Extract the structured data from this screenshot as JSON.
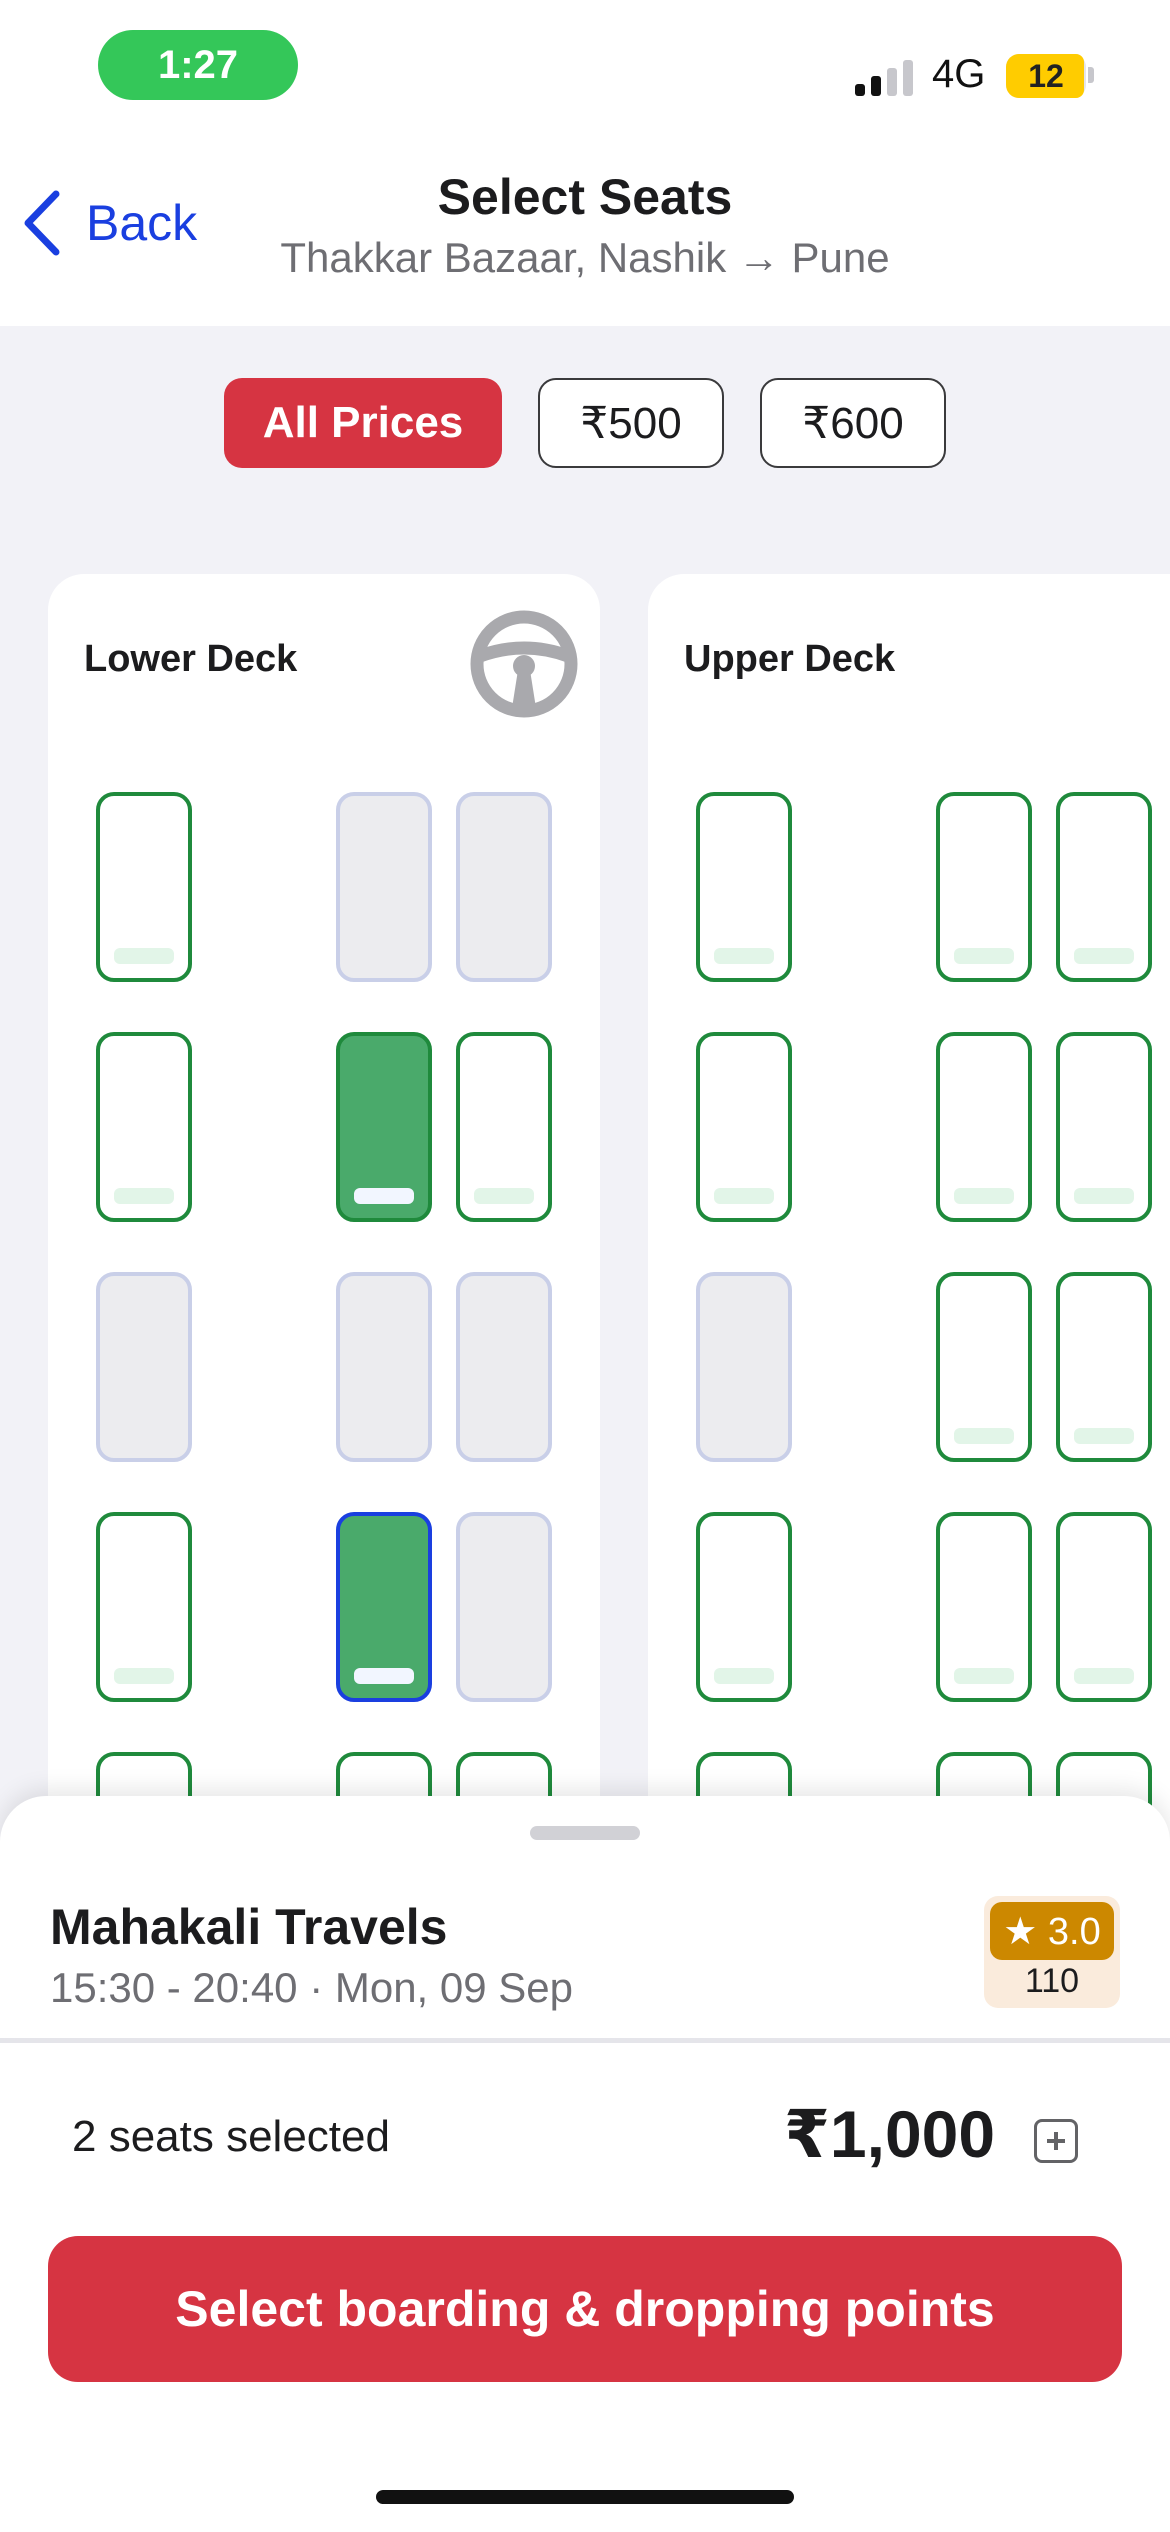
{
  "status_bar": {
    "time": "1:27",
    "network": "4G",
    "battery": "12",
    "colors": {
      "time_pill": "#34c759",
      "battery": "#ffcc00"
    }
  },
  "header": {
    "back_label": "Back",
    "title": "Select Seats",
    "subtitle": "Thakkar Bazaar, Nashik → Pune"
  },
  "filters": [
    {
      "label": "All Prices",
      "active": true
    },
    {
      "label": "₹500",
      "active": false
    },
    {
      "label": "₹600",
      "active": false
    }
  ],
  "decks": {
    "lower": {
      "title": "Lower Deck",
      "rows": [
        [
          "available",
          "unavailable",
          "unavailable"
        ],
        [
          "available",
          "selected",
          "available"
        ],
        [
          "unavailable",
          "unavailable",
          "unavailable"
        ],
        [
          "available",
          "selected-focused",
          "unavailable"
        ]
      ]
    },
    "upper": {
      "title": "Upper Deck",
      "rows": [
        [
          "available",
          "available",
          "available"
        ],
        [
          "available",
          "available",
          "available"
        ],
        [
          "unavailable",
          "available",
          "available"
        ],
        [
          "available",
          "available",
          "available"
        ]
      ]
    }
  },
  "operator": {
    "name": "Mahakali Travels",
    "timing": "15:30 - 20:40 · Mon, 09 Sep",
    "rating": "★ 3.0",
    "reviews": "110"
  },
  "summary": {
    "seats_selected": "2 seats selected",
    "total": "₹1,000"
  },
  "cta": {
    "label": "Select boarding & dropping points",
    "color": "#d63442"
  }
}
